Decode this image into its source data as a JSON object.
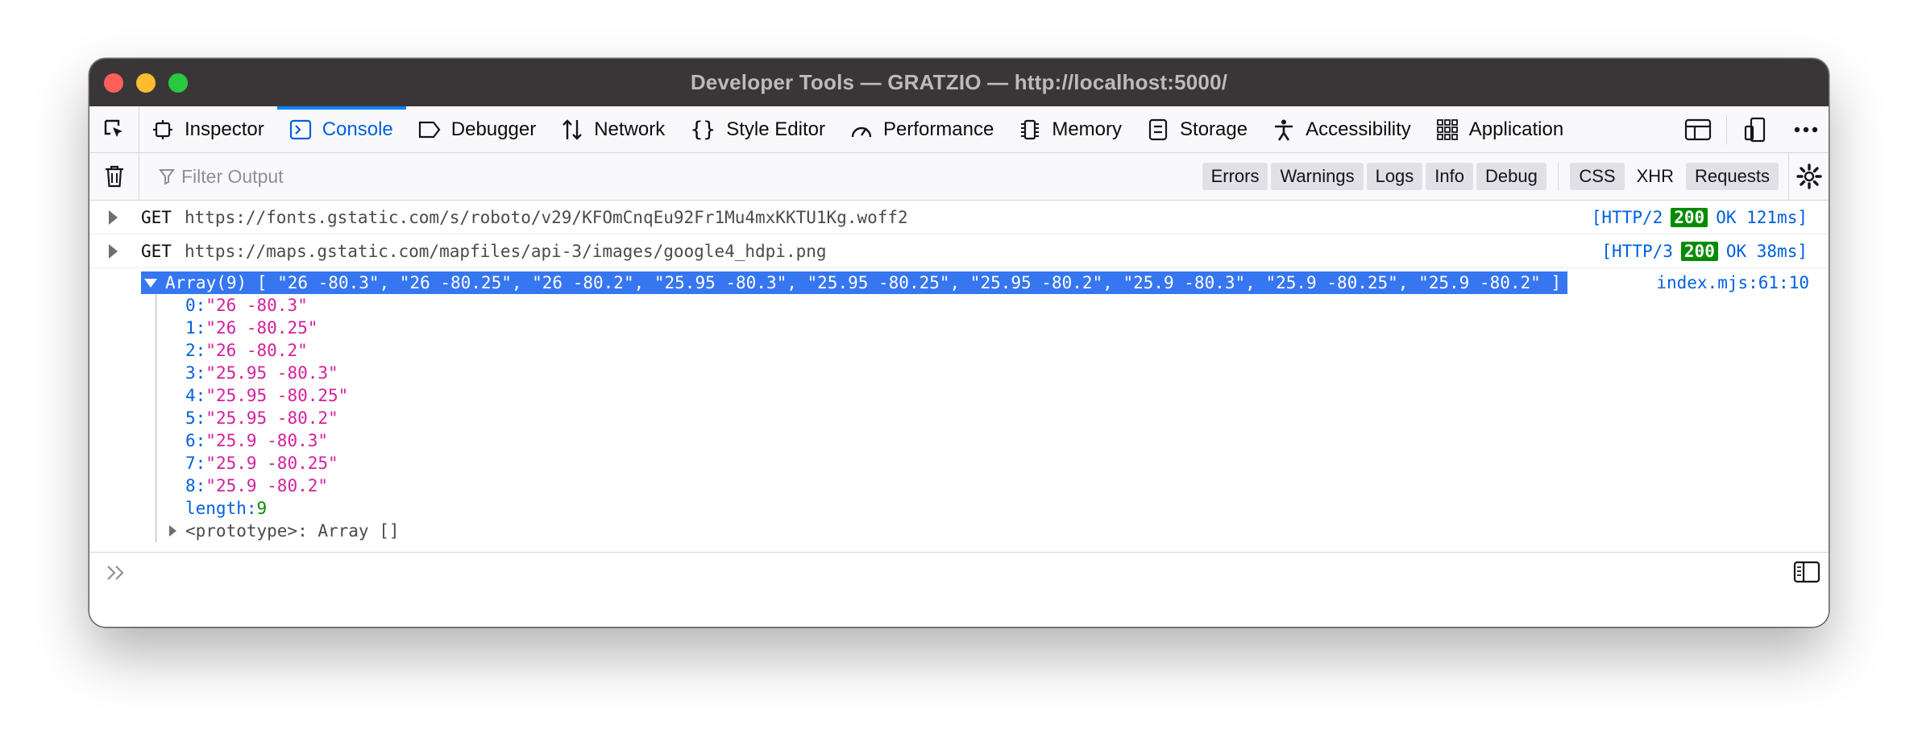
{
  "window": {
    "title": "Developer Tools — GRATZIO — http://localhost:5000/"
  },
  "tabs": [
    {
      "label": "Inspector",
      "icon": "inspector-icon"
    },
    {
      "label": "Console",
      "icon": "console-icon",
      "active": true
    },
    {
      "label": "Debugger",
      "icon": "debugger-icon"
    },
    {
      "label": "Network",
      "icon": "network-icon"
    },
    {
      "label": "Style Editor",
      "icon": "style-editor-icon"
    },
    {
      "label": "Performance",
      "icon": "performance-icon"
    },
    {
      "label": "Memory",
      "icon": "memory-icon"
    },
    {
      "label": "Storage",
      "icon": "storage-icon"
    },
    {
      "label": "Accessibility",
      "icon": "accessibility-icon"
    },
    {
      "label": "Application",
      "icon": "application-icon"
    }
  ],
  "filter": {
    "placeholder": "Filter Output",
    "buttons": [
      "Errors",
      "Warnings",
      "Logs",
      "Info",
      "Debug"
    ],
    "extra_buttons": [
      {
        "label": "CSS",
        "active": true
      },
      {
        "label": "XHR",
        "active": false
      },
      {
        "label": "Requests",
        "active": true
      }
    ]
  },
  "console": {
    "network_rows": [
      {
        "method": "GET",
        "url": "https://fonts.gstatic.com/s/roboto/v29/KFOmCnqEu92Fr1Mu4mxKKTU1Kg.woff2",
        "protocol": "[HTTP/2",
        "code": "200",
        "status_text": "OK 121ms]"
      },
      {
        "method": "GET",
        "url": "https://maps.gstatic.com/mapfiles/api-3/images/google4_hdpi.png",
        "protocol": "[HTTP/3",
        "code": "200",
        "status_text": "OK 38ms]"
      }
    ],
    "array_summary": "Array(9) [ \"26 -80.3\", \"26 -80.25\", \"26 -80.2\", \"25.95 -80.3\", \"25.95 -80.25\", \"25.95 -80.2\", \"25.9 -80.3\", \"25.9 -80.25\", \"25.9 -80.2\" ]",
    "location": "index.mjs:61:10",
    "items": [
      {
        "key": "0:",
        "value": "\"26 -80.3\""
      },
      {
        "key": "1:",
        "value": "\"26 -80.25\""
      },
      {
        "key": "2:",
        "value": "\"26 -80.2\""
      },
      {
        "key": "3:",
        "value": "\"25.95 -80.3\""
      },
      {
        "key": "4:",
        "value": "\"25.95 -80.25\""
      },
      {
        "key": "5:",
        "value": "\"25.95 -80.2\""
      },
      {
        "key": "6:",
        "value": "\"25.9 -80.3\""
      },
      {
        "key": "7:",
        "value": "\"25.9 -80.25\""
      },
      {
        "key": "8:",
        "value": "\"25.9 -80.2\""
      }
    ],
    "length_key": "length:",
    "length_value": "9",
    "prototype": "<prototype>: Array []"
  },
  "colors": {
    "accent": "#0060df",
    "selection": "#3676f0",
    "string": "#d4209c",
    "number": "#058b00"
  }
}
